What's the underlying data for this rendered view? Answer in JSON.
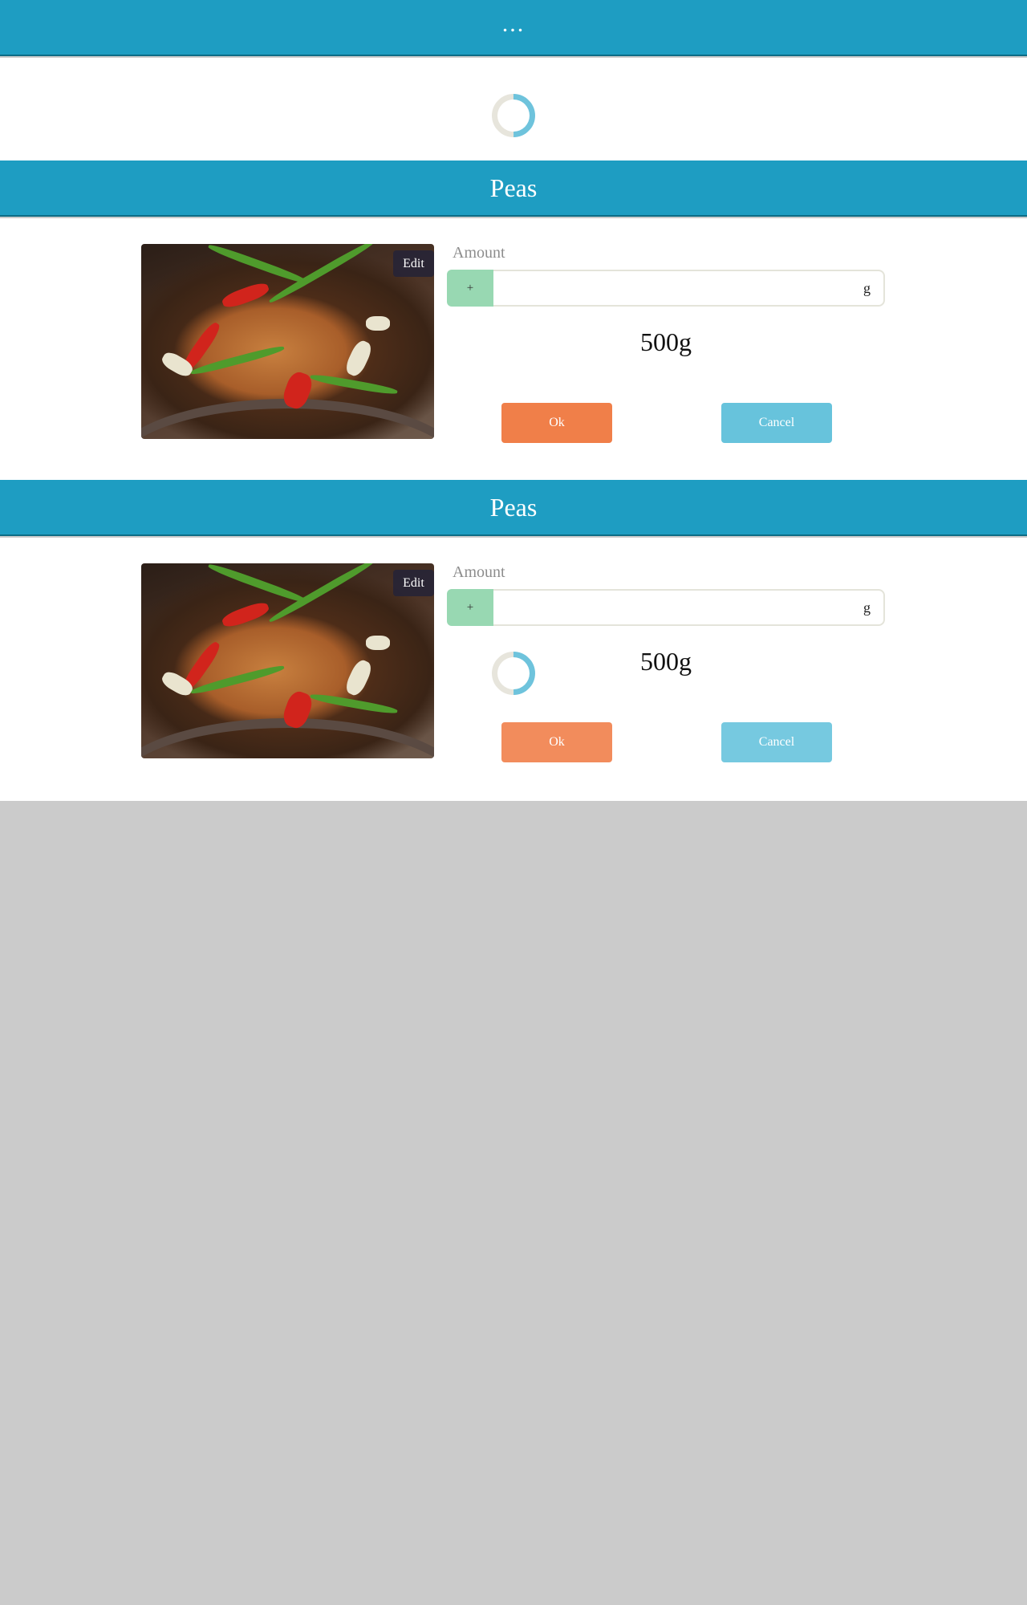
{
  "topbar": {
    "title": "..."
  },
  "cards": [
    {
      "title": "Peas",
      "edit_label": "Edit",
      "amount_label": "Amount",
      "plus_label": "+",
      "unit": "g",
      "amount_value": "500g",
      "ok_label": "Ok",
      "cancel_label": "Cancel",
      "photo_icon": "food-photo"
    },
    {
      "title": "Peas",
      "edit_label": "Edit",
      "amount_label": "Amount",
      "plus_label": "+",
      "unit": "g",
      "amount_value": "500g",
      "ok_label": "Ok",
      "cancel_label": "Cancel",
      "photo_icon": "food-photo"
    }
  ],
  "colors": {
    "header": "#1e9dc2",
    "ok": "#f07f49",
    "cancel": "#67c3dc",
    "plus": "#98d8b2",
    "spinner": "#6ec3dc",
    "background": "#cbcbcb"
  }
}
